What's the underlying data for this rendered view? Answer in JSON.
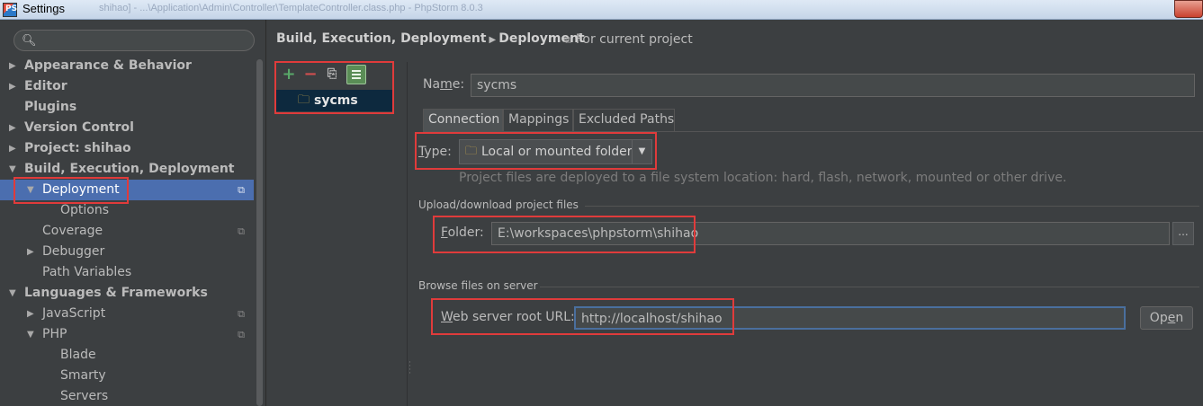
{
  "window": {
    "title": "Settings",
    "faded_title": "shihao] - ...\\Application\\Admin\\Controller\\TemplateController.class.php - PhpStorm 8.0.3",
    "icon_name": "phpstorm-icon"
  },
  "sidebar": {
    "search": {
      "value": "",
      "placeholder": ""
    },
    "items": [
      {
        "label": "Appearance & Behavior",
        "level": 0,
        "bold": true,
        "arrow": "▶"
      },
      {
        "label": "Editor",
        "level": 0,
        "bold": true,
        "arrow": "▶"
      },
      {
        "label": "Plugins",
        "level": 0,
        "bold": true,
        "arrow": ""
      },
      {
        "label": "Version Control",
        "level": 0,
        "bold": true,
        "arrow": "▶"
      },
      {
        "label": "Project: shihao",
        "level": 0,
        "bold": true,
        "arrow": "▶"
      },
      {
        "label": "Build, Execution, Deployment",
        "level": 0,
        "bold": true,
        "arrow": "▼"
      },
      {
        "label": "Deployment",
        "level": 1,
        "bold": false,
        "arrow": "▼",
        "selected": true,
        "project_icon": true
      },
      {
        "label": "Options",
        "level": 2,
        "bold": false,
        "arrow": ""
      },
      {
        "label": "Coverage",
        "level": 1,
        "bold": false,
        "arrow": "",
        "project_icon": true
      },
      {
        "label": "Debugger",
        "level": 1,
        "bold": false,
        "arrow": "▶"
      },
      {
        "label": "Path Variables",
        "level": 1,
        "bold": false,
        "arrow": ""
      },
      {
        "label": "Languages & Frameworks",
        "level": 0,
        "bold": true,
        "arrow": "▼"
      },
      {
        "label": "JavaScript",
        "level": 1,
        "bold": false,
        "arrow": "▶",
        "project_icon": true
      },
      {
        "label": "PHP",
        "level": 1,
        "bold": false,
        "arrow": "▼",
        "project_icon": true
      },
      {
        "label": "Blade",
        "level": 2,
        "bold": false,
        "arrow": ""
      },
      {
        "label": "Smarty",
        "level": 2,
        "bold": false,
        "arrow": ""
      },
      {
        "label": "Servers",
        "level": 2,
        "bold": false,
        "arrow": ""
      }
    ]
  },
  "header": {
    "crumb_parent": "Build, Execution, Deployment",
    "crumb_sep": "▶",
    "crumb_current": "Deployment",
    "for_project": "For current project"
  },
  "servers": {
    "toolbar": {
      "add": "+",
      "remove": "−",
      "copy": "⎘"
    },
    "items": [
      {
        "name": "sycms"
      }
    ]
  },
  "form": {
    "name_label_pre": "Na",
    "name_label_u": "m",
    "name_label_post": "e:",
    "name_value": "sycms",
    "tabs": [
      {
        "label": "Connection",
        "active": true
      },
      {
        "label": "Mappings",
        "active": false
      },
      {
        "label": "Excluded Paths",
        "active": false
      }
    ],
    "type_label_u": "T",
    "type_label_post": "ype:",
    "type_value": "Local or mounted folder",
    "type_hint": "Project files are deployed to a file system location: hard, flash, network, mounted or other drive.",
    "upload_section": "Upload/download project files",
    "folder_label_u": "F",
    "folder_label_post": "older:",
    "folder_value": "E:\\workspaces\\phpstorm\\shihao",
    "browse_label": "...",
    "browse_section": "Browse files on server",
    "url_label_u": "W",
    "url_label_post": "eb server root URL:",
    "url_value": "http://localhost/shihao",
    "open_pre": "Op",
    "open_u": "e",
    "open_post": "n"
  },
  "colors": {
    "background": "#3c3f41",
    "selection": "#4b6eaf",
    "annotation": "#e03b3b",
    "add": "#59a869",
    "remove": "#d34f4f"
  }
}
